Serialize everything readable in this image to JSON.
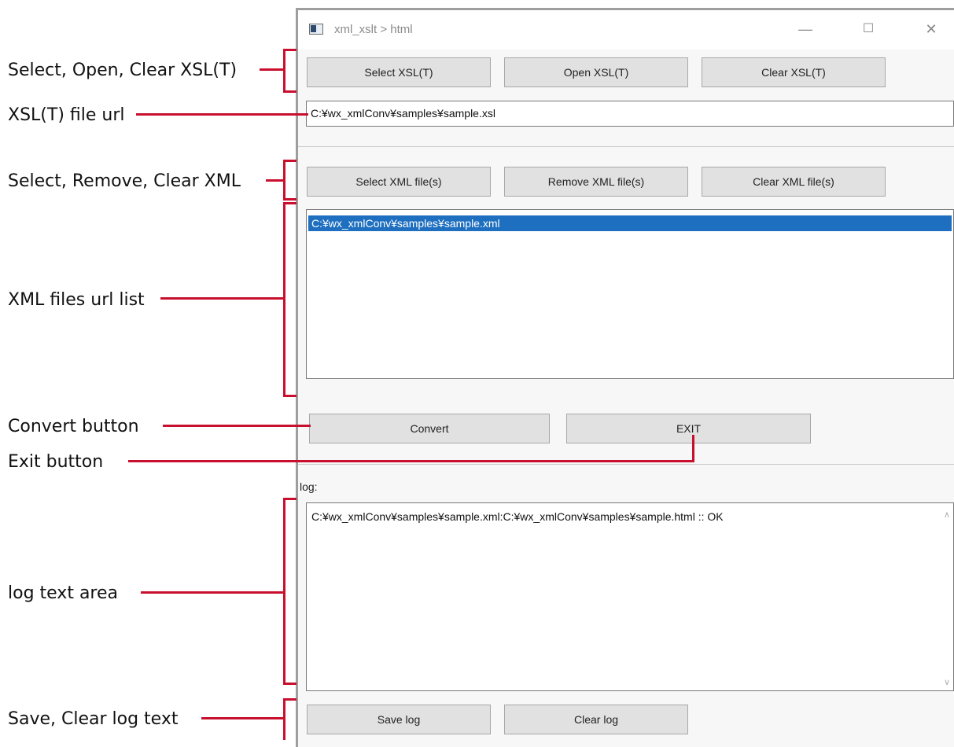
{
  "window": {
    "title": "xml_xslt > html",
    "min_glyph": "—",
    "max_glyph": "☐",
    "close_glyph": "✕"
  },
  "xsl_buttons": {
    "select": "Select XSL(T)",
    "open": "Open XSL(T)",
    "clear": "Clear XSL(T)"
  },
  "xsl_url": "C:¥wx_xmlConv¥samples¥sample.xsl",
  "xml_buttons": {
    "select": "Select XML file(s)",
    "remove": "Remove XML file(s)",
    "clear": "Clear XML file(s)"
  },
  "xml_list": [
    "C:¥wx_xmlConv¥samples¥sample.xml"
  ],
  "action_buttons": {
    "convert": "Convert",
    "exit": "EXIT"
  },
  "log": {
    "label": "log:",
    "text": "C:¥wx_xmlConv¥samples¥sample.xml:C:¥wx_xmlConv¥samples¥sample.html :: OK",
    "scroll_up": "∧",
    "scroll_down": "∨"
  },
  "log_buttons": {
    "save": "Save log",
    "clear": "Clear log"
  },
  "annotations": {
    "xsl_buttons": "Select, Open, Clear XSL(T)",
    "xsl_url": "XSL(T)  file url",
    "xml_buttons": "Select, Remove, Clear XML",
    "xml_list": "XML  files url list",
    "convert": "Convert button",
    "exit": "Exit button",
    "log_area": "log text area",
    "log_buttons": "Save, Clear log text"
  },
  "colors": {
    "annotation_line": "#c8102e",
    "selection": "#1e6fbf",
    "button_face": "#e1e1e1"
  }
}
